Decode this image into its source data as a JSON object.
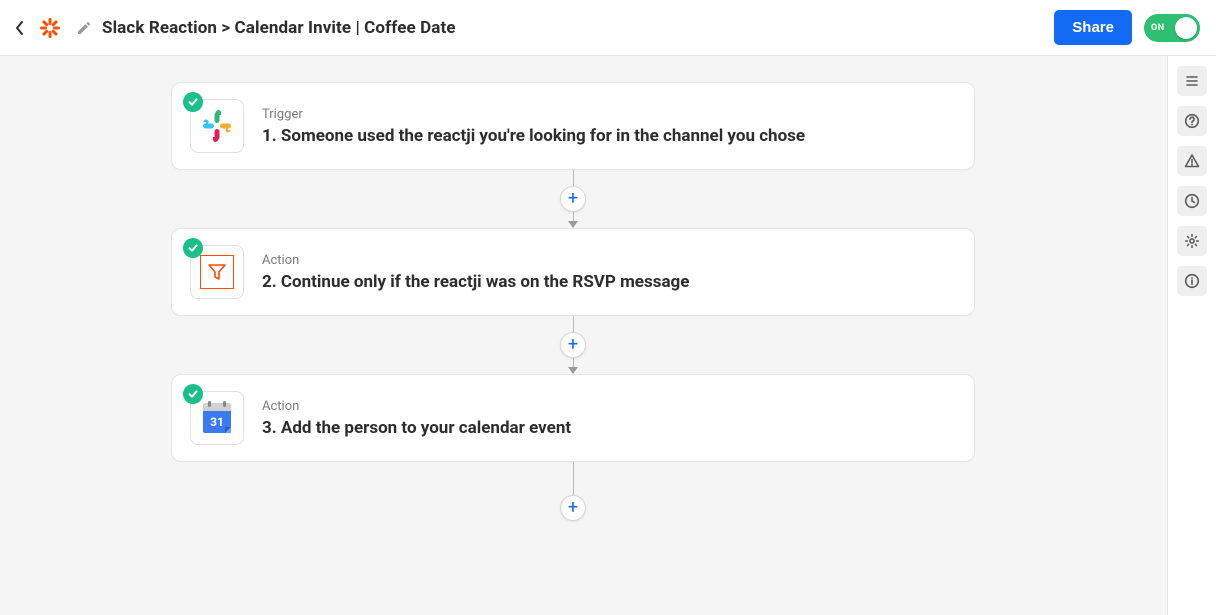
{
  "header": {
    "title": "Slack Reaction > Calendar Invite | Coffee Date",
    "share_label": "Share",
    "toggle_state_label": "ON"
  },
  "steps": [
    {
      "kicker": "Trigger",
      "title": "1. Someone used the reactji you're looking for in the channel you chose",
      "app": "slack"
    },
    {
      "kicker": "Action",
      "title": "2. Continue only if the reactji was on the RSVP message",
      "app": "filter"
    },
    {
      "kicker": "Action",
      "title": "3. Add the person to your calendar event",
      "app": "google-calendar"
    }
  ],
  "gcal_day": "31"
}
